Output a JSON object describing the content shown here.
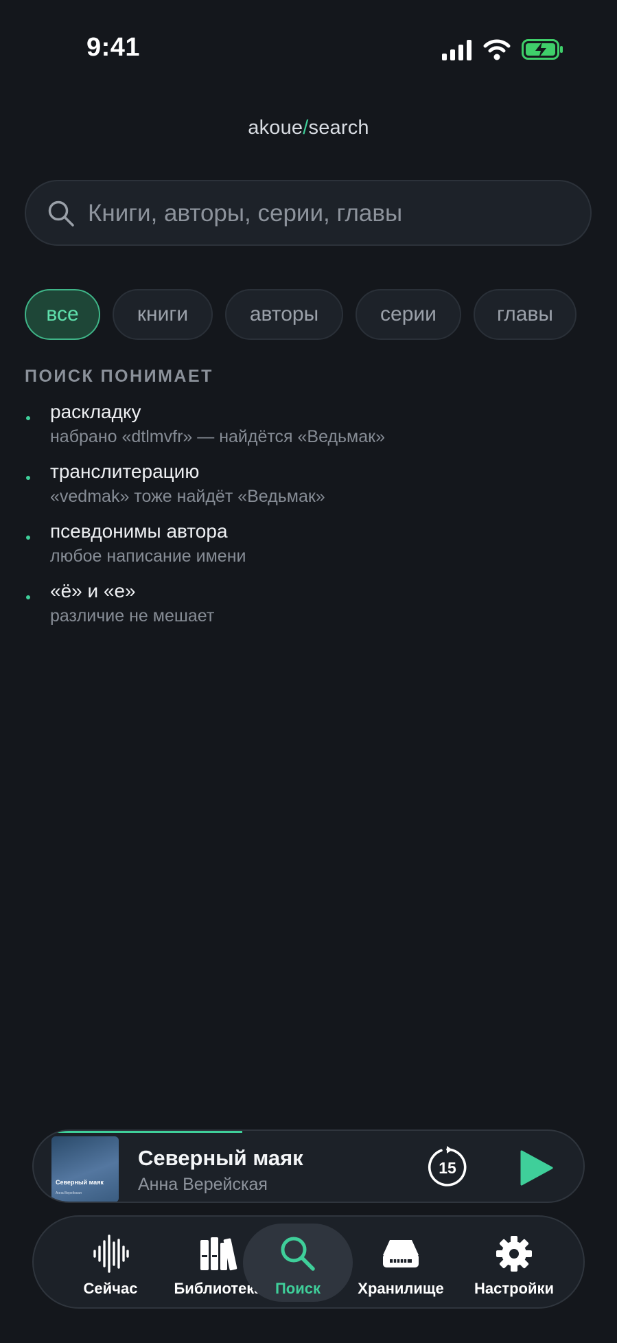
{
  "status_bar": {
    "time": "9:41"
  },
  "header": {
    "brand_prefix": "akoue",
    "brand_slash": "/",
    "brand_suffix": "search"
  },
  "search": {
    "placeholder": "Книги, авторы, серии, главы",
    "value": ""
  },
  "filters": {
    "selected": "все",
    "items": [
      "все",
      "книги",
      "авторы",
      "серии",
      "главы"
    ]
  },
  "hints": {
    "title": "ПОИСК ПОНИМАЕТ",
    "items": [
      {
        "title": "раскладку",
        "subtitle": "набрано «dtlmvfr» — найдётся «Ведьмак»"
      },
      {
        "title": "транслитерацию",
        "subtitle": "«vedmak» тоже найдёт «Ведьмак»"
      },
      {
        "title": "псевдонимы автора",
        "subtitle": "любое написание имени"
      },
      {
        "title": "«ё» и «е»",
        "subtitle": "различие не мешает"
      }
    ]
  },
  "player": {
    "title": "Северный маяк",
    "author": "Анна Верейская",
    "cover_title": "Северный маяк",
    "cover_author": "Анна Верейская",
    "rewind_seconds": "15",
    "progress": 0.38
  },
  "tabs": {
    "active": "Поиск",
    "items": [
      {
        "label": "Сейчас",
        "icon": "waveform-icon"
      },
      {
        "label": "Библиотека",
        "icon": "books-icon"
      },
      {
        "label": "Поиск",
        "icon": "search-icon"
      },
      {
        "label": "Хранилище",
        "icon": "storage-drive-icon"
      },
      {
        "label": "Настройки",
        "icon": "gear-icon"
      }
    ]
  },
  "colors": {
    "background": "#14171c",
    "accent": "#3fcf9a",
    "surface": "#1d2229",
    "muted_text": "#8d939c"
  }
}
